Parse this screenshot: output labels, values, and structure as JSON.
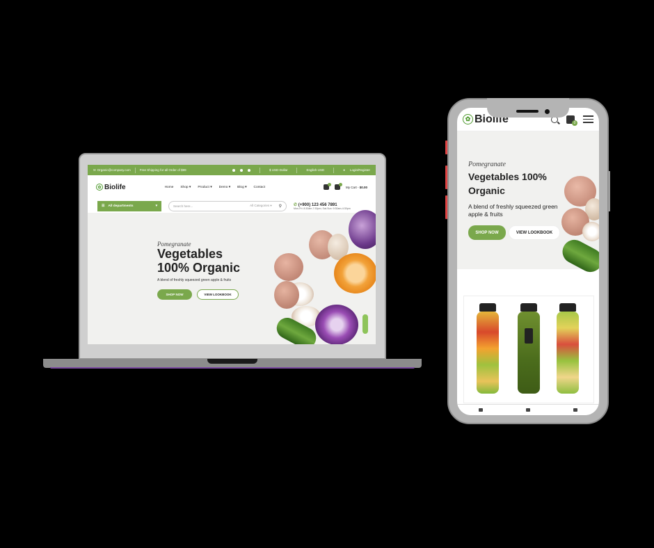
{
  "brand": {
    "name": "Biolife",
    "logo_icon": "leaf-icon",
    "accent": "#7aa84c"
  },
  "laptop": {
    "topbar": {
      "email": "Organic@company.com",
      "shipping": "Free Shipping for all Order of $99",
      "currency": "$ USD-Dollar",
      "language": "English-USD",
      "login": "Login/Register"
    },
    "nav": [
      "Home",
      "Shop",
      "Product",
      "Demo",
      "Blog",
      "Contact"
    ],
    "cart": {
      "label": "My Cart -",
      "total": "$0.00"
    },
    "departments": "All departments",
    "search": {
      "placeholder": "Search here...",
      "category": "All Categories"
    },
    "phone": "(+900) 123 456 7891",
    "hours": "Mon-Fri: 8:30am-7:30pm; Sat-Sun: 9:30am-4:30pm",
    "hero": {
      "subtitle": "Pomegranate",
      "title_line1": "Vegetables",
      "title_line2": "100% Organic",
      "description": "A blend of freshly squeezed green apple & fruits",
      "shop_button": "SHOP NOW",
      "lookbook_button": "VIEW LOOKBOOK"
    }
  },
  "phone": {
    "cart_count": "0",
    "hero": {
      "subtitle": "Pomegranate",
      "title_line1": "Vegetables 100%",
      "title_line2": "Organic",
      "description": "A blend of freshly squeezed green apple & fruits",
      "shop_button": "SHOP NOW",
      "lookbook_button": "VIEW LOOKBOOK"
    }
  }
}
